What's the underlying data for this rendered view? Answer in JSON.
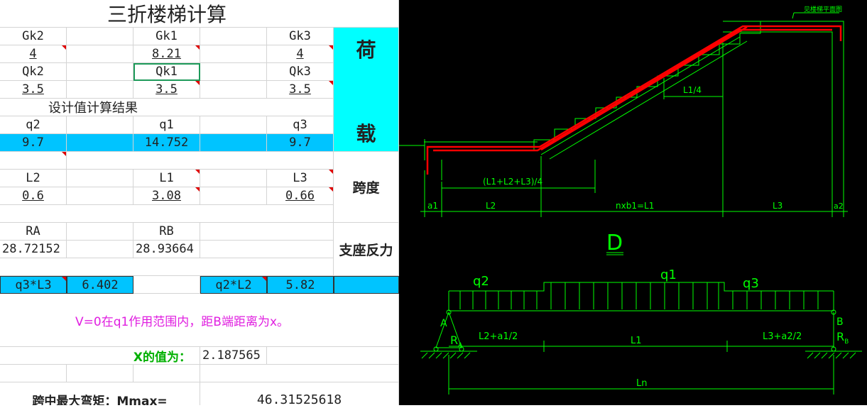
{
  "sheet": {
    "title": "三折楼梯计算",
    "labels": {
      "gk2": "Gk2",
      "gk1": "Gk1",
      "gk3": "Gk3",
      "qk2": "Qk2",
      "qk1": "Qk1",
      "qk3": "Qk3",
      "design_header": "设计值计算结果",
      "q2": "q2",
      "q1": "q1",
      "q3": "q3",
      "l2": "L2",
      "l1": "L1",
      "l3": "L3",
      "ra": "RA",
      "rb": "RB",
      "q3l3": "q3*L3",
      "q2l2": "q2*L2",
      "note": "V=0在q1作用范围内，距B端距离为x。",
      "x_label": "X的值为：",
      "mmax_label": "跨中最大弯矩：Mmax="
    },
    "values": {
      "gk2": "4",
      "gk1": "8.21",
      "gk3": "4",
      "qk2": "3.5",
      "qk1": "3.5",
      "qk3": "3.5",
      "q2": "9.7",
      "q1": "14.752",
      "q3": "9.7",
      "l2": "0.6",
      "l1": "3.08",
      "l3": "0.66",
      "ra": "28.72152",
      "rb": "28.93664",
      "q3l3": "6.402",
      "q2l2": "5.82",
      "x": "2.187565",
      "mmax": "46.31525618"
    },
    "side": {
      "load_1": "荷",
      "load_2": "载",
      "span": "跨度",
      "reaction": "支座反力"
    },
    "colors": {
      "cyan": "#00ffff",
      "blue": "#00c4ff",
      "magenta": "#e020e0",
      "green": "#00b000"
    }
  },
  "cad": {
    "top_note": "见楼梯平面图",
    "labels": {
      "l1_quarter": "L1/4",
      "sum_quarter": "(L1+L2+L3)/4",
      "a1": "a1",
      "l2": "L2",
      "nxb1": "nxb1=L1",
      "l3": "L3",
      "a2": "a2",
      "section": "D",
      "q2": "q2",
      "q1": "q1",
      "q3": "q3",
      "a": "A",
      "b": "B",
      "ra": "R",
      "ra_sub": "A",
      "rb": "R",
      "rb_sub": "B",
      "l2_a1": "L2+a1/2",
      "l1": "L1",
      "l3_a2": "L3+a2/2",
      "ln": "Ln"
    },
    "colors": {
      "background": "#000000",
      "line": "#00ff00",
      "rebar": "#ff0000",
      "text": "#00ff00"
    }
  }
}
